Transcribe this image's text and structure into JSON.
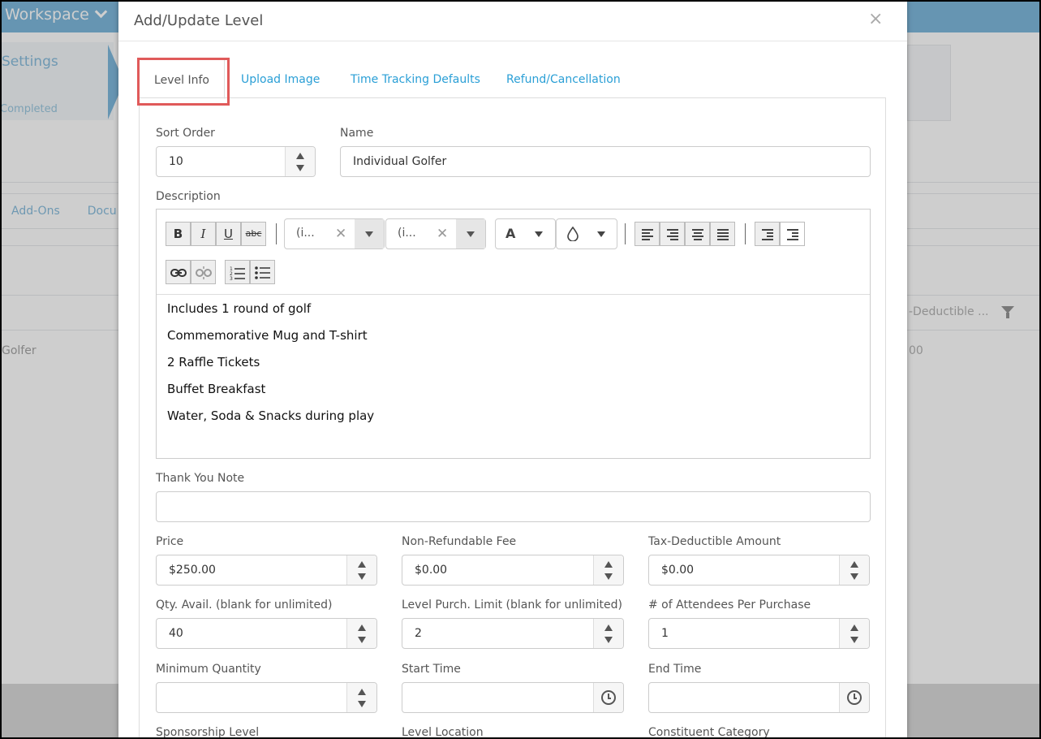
{
  "background": {
    "workspace_label": "Workspace",
    "settings_label": "Settings",
    "completed_label": "Completed",
    "tabs": [
      "Add-Ons",
      "Docu"
    ],
    "row_name": "Golfer",
    "column_header": "-Deductible ...",
    "row_value": "00"
  },
  "modal": {
    "title": "Add/Update Level",
    "close_glyph": "×",
    "tabs": [
      {
        "label": "Level Info",
        "active": true
      },
      {
        "label": "Upload Image",
        "active": false
      },
      {
        "label": "Time Tracking Defaults",
        "active": false
      },
      {
        "label": "Refund/Cancellation",
        "active": false
      }
    ]
  },
  "form": {
    "sort_order": {
      "label": "Sort Order",
      "value": "10"
    },
    "name": {
      "label": "Name",
      "value": "Individual Golfer"
    },
    "description": {
      "label": "Description",
      "font_family_value": "(i...",
      "font_size_value": "(i...",
      "font_color_glyph": "A",
      "content": [
        "Includes 1 round of golf",
        "Commemorative Mug and T-shirt",
        "2 Raffle Tickets",
        "Buffet Breakfast",
        "Water, Soda & Snacks during play"
      ]
    },
    "thank_you_note": {
      "label": "Thank You Note",
      "value": ""
    },
    "price": {
      "label": "Price",
      "value": "$250.00"
    },
    "non_refundable_fee": {
      "label": "Non-Refundable Fee",
      "value": "$0.00"
    },
    "tax_deductible_amount": {
      "label": "Tax-Deductible Amount",
      "value": "$0.00"
    },
    "qty_avail": {
      "label": "Qty. Avail. (blank for unlimited)",
      "value": "40"
    },
    "level_purch_limit": {
      "label": "Level Purch. Limit (blank for unlimited)",
      "value": "2"
    },
    "attendees_per_purchase": {
      "label": "# of Attendees Per Purchase",
      "value": "1"
    },
    "minimum_quantity": {
      "label": "Minimum Quantity",
      "value": ""
    },
    "start_time": {
      "label": "Start Time",
      "value": ""
    },
    "end_time": {
      "label": "End Time",
      "value": ""
    },
    "sponsorship_level": {
      "label": "Sponsorship Level"
    },
    "level_location": {
      "label": "Level Location"
    },
    "constituent_category": {
      "label": "Constituent Category"
    }
  },
  "icons": {
    "bold": "B",
    "italic": "I",
    "underline": "U",
    "strikethrough": "abc",
    "link": "link-icon",
    "unlink": "unlink-icon",
    "ordered_list": "ordered-list-icon",
    "bullet_list": "bullet-list-icon",
    "background_color": "droplet-icon",
    "time": "clock-icon",
    "filter": "funnel-icon"
  },
  "colors": {
    "accent": "#2a9fd6",
    "topbar": "#6fb1d8",
    "highlight": "#e05a5a"
  }
}
